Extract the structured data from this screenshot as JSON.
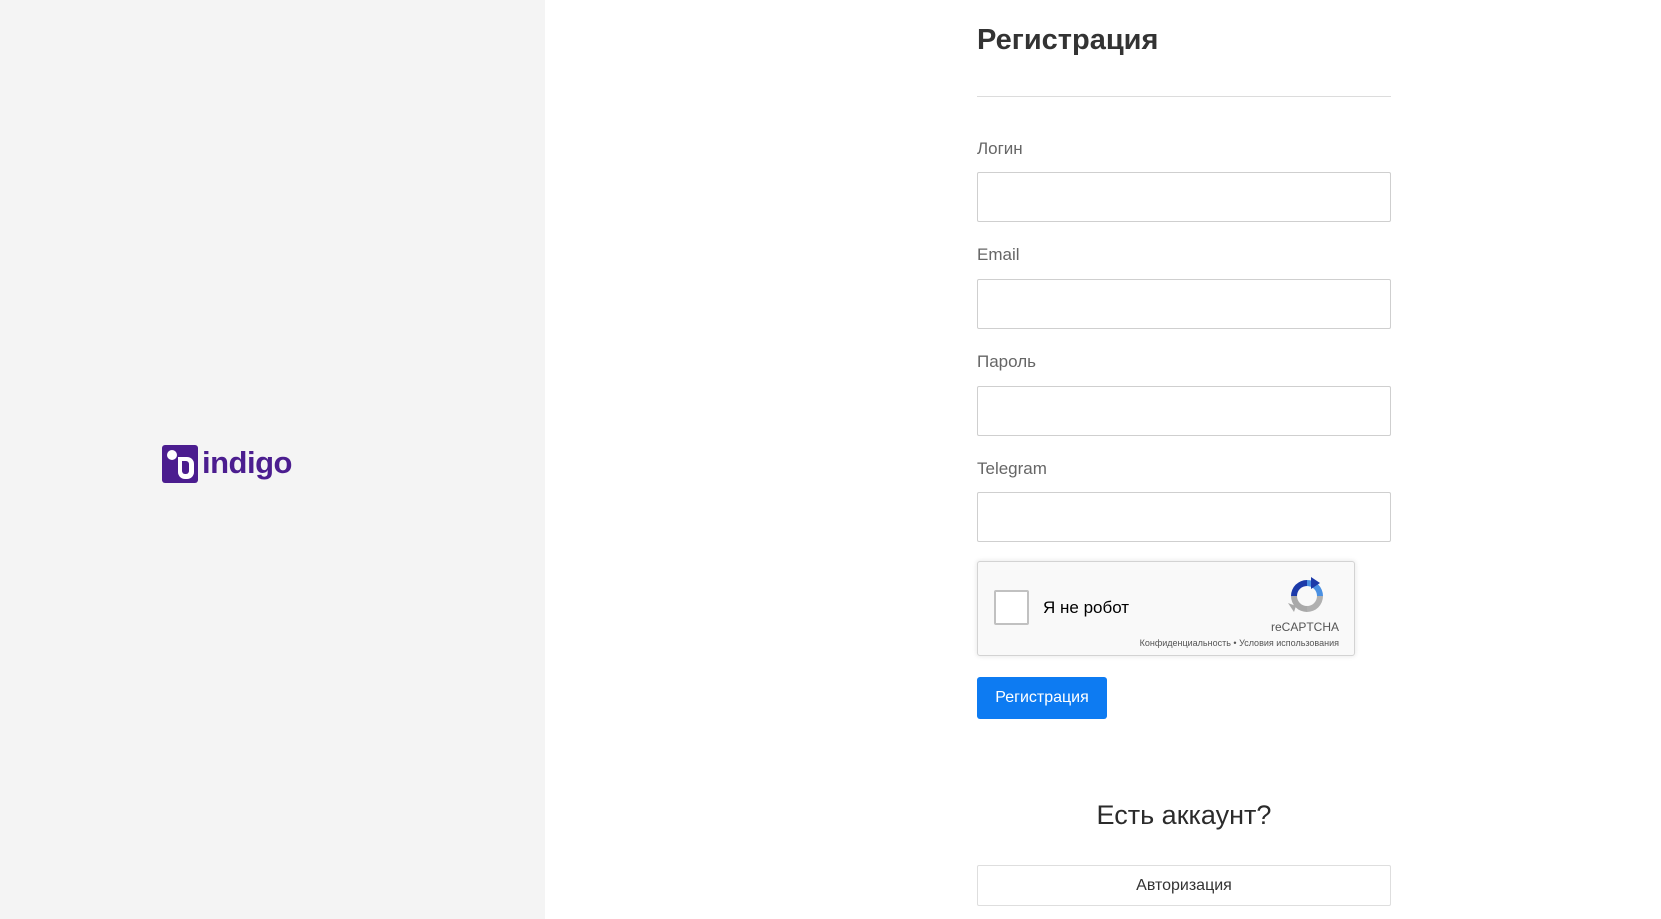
{
  "brand": {
    "logo_text": "indigo",
    "color": "#4b1d8f"
  },
  "form": {
    "title": "Регистрация",
    "fields": [
      {
        "label": "Логин",
        "value": "",
        "placeholder": ""
      },
      {
        "label": "Email",
        "value": "",
        "placeholder": ""
      },
      {
        "label": "Пароль",
        "value": "",
        "placeholder": ""
      },
      {
        "label": "Telegram",
        "value": "",
        "placeholder": ""
      }
    ],
    "recaptcha": {
      "label": "Я не робот",
      "brand": "reCAPTCHA",
      "privacy_link": "Конфиденциальность",
      "separator": "•",
      "terms_link": "Условия использования",
      "checked": false
    },
    "submit_label": "Регистрация",
    "submit_color": "#0d7bf2"
  },
  "account": {
    "heading": "Есть аккаунт?",
    "login_label": "Авторизация"
  }
}
